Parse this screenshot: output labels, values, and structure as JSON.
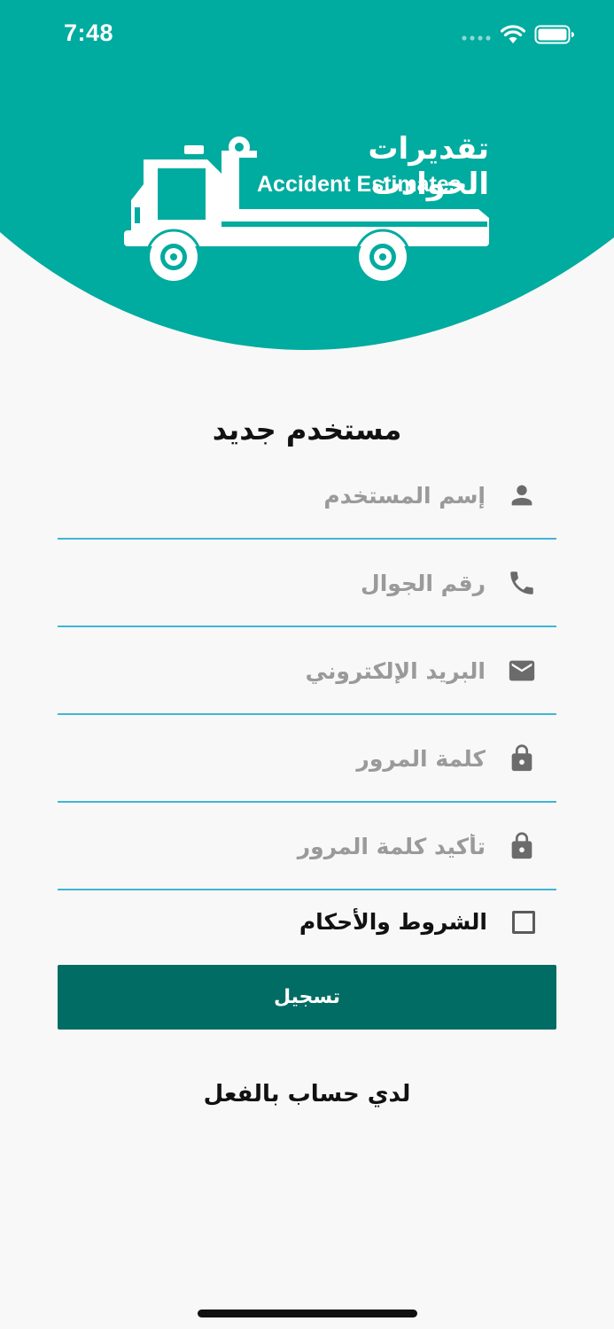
{
  "status_bar": {
    "time": "7:48"
  },
  "brand": {
    "name_ar": "تقديرات الحوادث",
    "name_en": "Accident Estimates",
    "color": "#00ab9f"
  },
  "form": {
    "title": "مستخدم جديد",
    "fields": [
      {
        "icon": "person-icon",
        "placeholder": "إسم المستخدم",
        "value": ""
      },
      {
        "icon": "phone-icon",
        "placeholder": "رقم الجوال",
        "value": ""
      },
      {
        "icon": "mail-icon",
        "placeholder": "البريد الإلكتروني",
        "value": ""
      },
      {
        "icon": "lock-icon",
        "placeholder": "كلمة المرور",
        "value": ""
      },
      {
        "icon": "lock-icon",
        "placeholder": "تأكيد كلمة المرور",
        "value": ""
      }
    ],
    "terms_label": "الشروط والأحكام",
    "terms_checked": false,
    "register_label": "تسجيل",
    "login_link": "لدي حساب بالفعل"
  },
  "colors": {
    "button": "#016c63",
    "field_underline": "#3fb6d6",
    "background": "#f8f8f8"
  }
}
